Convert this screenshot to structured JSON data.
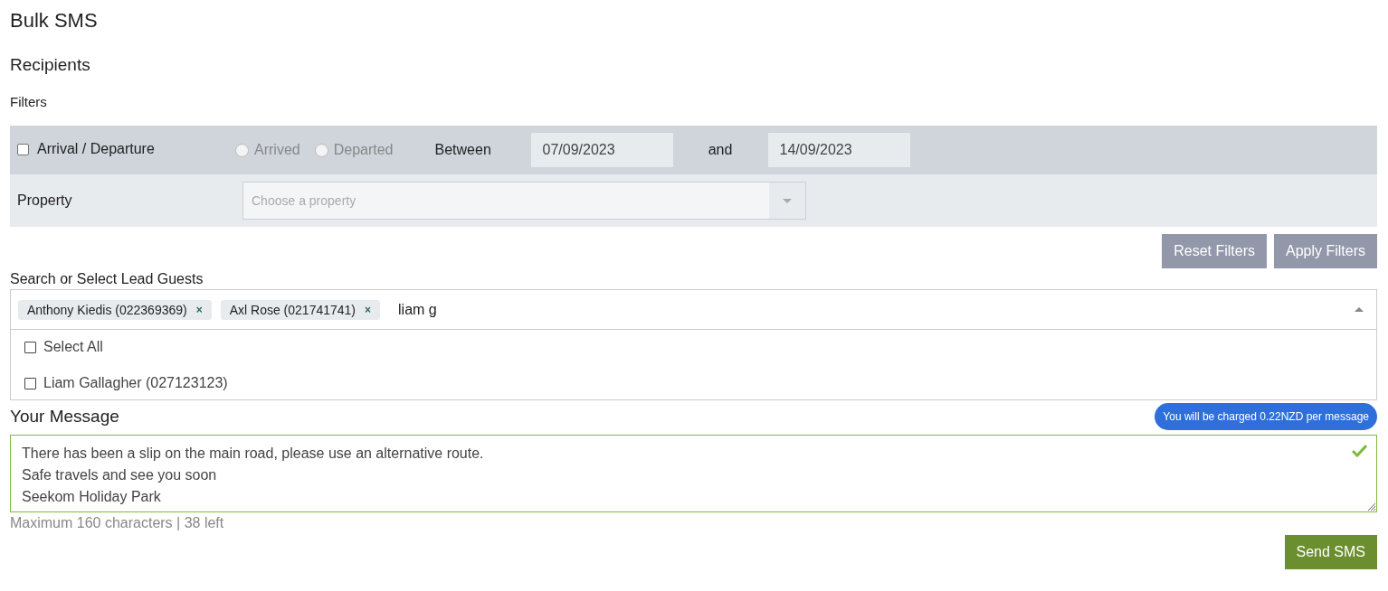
{
  "title": "Bulk SMS",
  "section": "Recipients",
  "filters_label": "Filters",
  "filters": {
    "arrival_departure": {
      "label": "Arrival / Departure",
      "checked": false
    },
    "radios": [
      {
        "label": "Arrived",
        "selected": false
      },
      {
        "label": "Departed",
        "selected": false
      }
    ],
    "between_label": "Between",
    "from_date": "07/09/2023",
    "and_label": "and",
    "to_date": "14/09/2023",
    "property_label": "Property",
    "property_placeholder": "Choose a property"
  },
  "filter_buttons": [
    "Reset Filters",
    "Apply Filters"
  ],
  "guests": {
    "label": "Search or Select Lead Guests",
    "tags": [
      {
        "label": "Anthony Kiedis (022369369)",
        "remove": "×"
      },
      {
        "label": "Axl Rose (021741741)",
        "remove": "×"
      }
    ],
    "search_value": "liam g",
    "options": [
      {
        "label": "Select All",
        "checked": false
      },
      {
        "label": "Liam Gallagher (027123123)",
        "checked": false
      }
    ]
  },
  "message": {
    "heading": "Your Message",
    "charge_note": "You will be charged 0.22NZD per message",
    "lines": [
      "There has been a slip on the main road, please use an alternative route.",
      "Safe travels and see you soon",
      "Seekom Holiday Park"
    ],
    "valid": true,
    "hint": "Maximum 160 characters | 38 left"
  },
  "send_button": "Send SMS"
}
